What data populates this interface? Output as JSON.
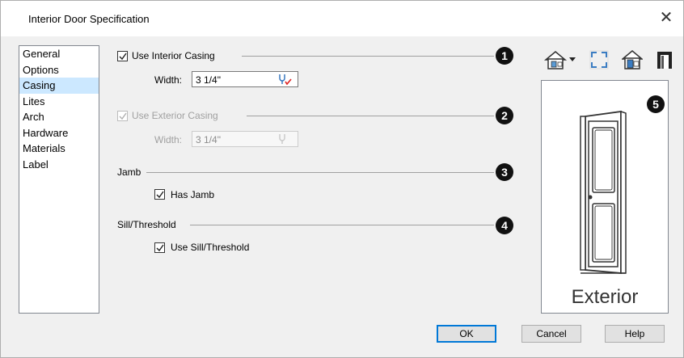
{
  "dialog": {
    "title": "Interior Door Specification"
  },
  "nav": {
    "items": [
      "General",
      "Options",
      "Casing",
      "Lites",
      "Arch",
      "Hardware",
      "Materials",
      "Label"
    ],
    "selected": "Casing"
  },
  "casing": {
    "interior": {
      "checkbox_label": "Use Interior Casing",
      "checked": true,
      "width_label": "Width:",
      "width_value": "3 1/4\""
    },
    "exterior": {
      "checkbox_label": "Use Exterior Casing",
      "checked": true,
      "disabled": true,
      "width_label": "Width:",
      "width_value": "3 1/4\""
    }
  },
  "jamb": {
    "section_label": "Jamb",
    "checkbox_label": "Has Jamb",
    "checked": true
  },
  "sill": {
    "section_label": "Sill/Threshold",
    "checkbox_label": "Use Sill/Threshold",
    "checked": true
  },
  "callouts": [
    "1",
    "2",
    "3",
    "4",
    "5"
  ],
  "preview": {
    "label": "Exterior"
  },
  "buttons": {
    "ok": "OK",
    "cancel": "Cancel",
    "help": "Help"
  },
  "toolbar_icons": [
    "house-view-dropdown-icon",
    "fill-window-icon",
    "house-door-icon",
    "door-frame-icon"
  ],
  "colors": {
    "selection": "#cce8ff",
    "default_button_border": "#0078d7",
    "callout": "#111111"
  }
}
